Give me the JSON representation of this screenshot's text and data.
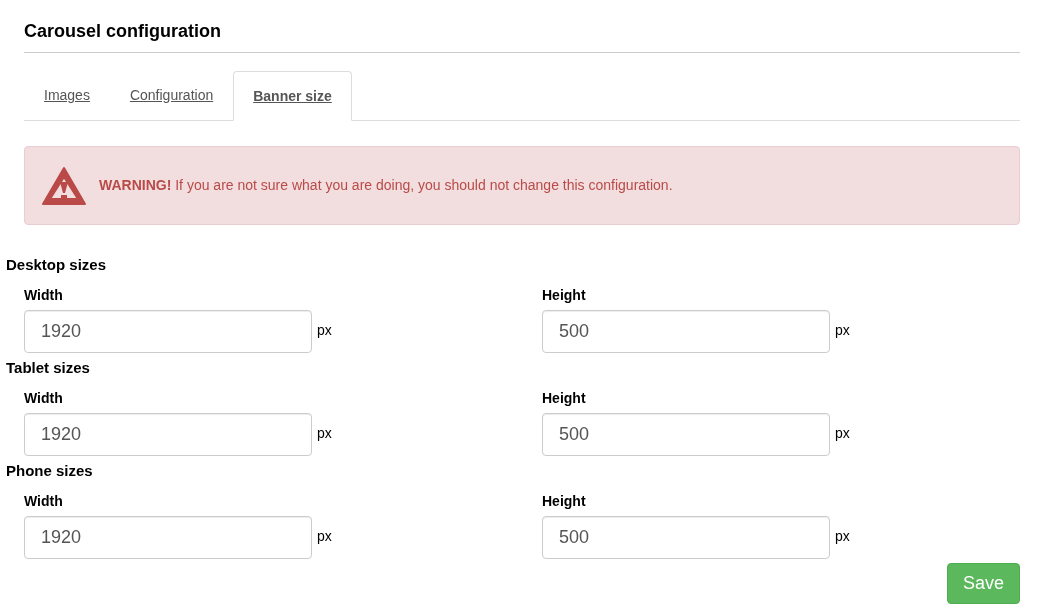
{
  "title": "Carousel configuration",
  "tabs": [
    {
      "label": "Images",
      "selected": false
    },
    {
      "label": "Configuration",
      "selected": false
    },
    {
      "label": "Banner size",
      "selected": true
    }
  ],
  "alert": {
    "text": "**WARNING!** If you are not sure what you are doing, you should not change this configuration."
  },
  "sections": [
    {
      "title": "Desktop sizes",
      "fields": [
        {
          "label": "Width",
          "value": "1920",
          "unit": "px"
        },
        {
          "label": "Height",
          "value": "500",
          "unit": "px"
        }
      ]
    },
    {
      "title": "Tablet sizes",
      "fields": [
        {
          "label": "Width",
          "value": "1920",
          "unit": "px"
        },
        {
          "label": "Height",
          "value": "500",
          "unit": "px"
        }
      ]
    },
    {
      "title": "Phone sizes",
      "fields": [
        {
          "label": "Width",
          "value": "1920",
          "unit": "px"
        },
        {
          "label": "Height",
          "value": "500",
          "unit": "px"
        }
      ]
    }
  ],
  "save_button": "Save"
}
